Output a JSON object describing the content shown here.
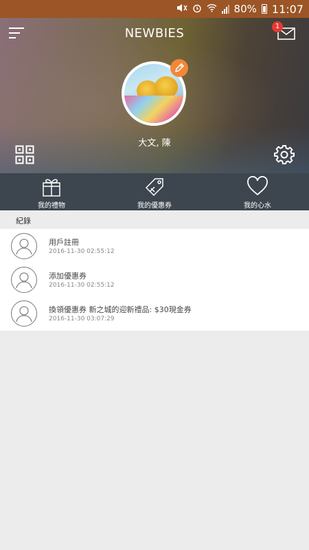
{
  "status_bar": {
    "battery": "80%",
    "time": "11:07",
    "icons": [
      "mute-icon",
      "alarm-icon",
      "wifi-icon",
      "signal-icon",
      "battery-icon"
    ]
  },
  "header": {
    "title": "NEWBIES",
    "mail_badge": "1",
    "user_name": "大文, 陳"
  },
  "tabs": [
    {
      "label": "我的禮物",
      "icon": "gift-icon"
    },
    {
      "label": "我的優惠券",
      "icon": "coupon-icon"
    },
    {
      "label": "我的心水",
      "icon": "heart-icon"
    }
  ],
  "records": {
    "heading": "紀錄",
    "items": [
      {
        "title": "用戶註冊",
        "time": "2016-11-30 02:55:12"
      },
      {
        "title": "添加優惠券",
        "time": "2016-11-30 02:55:12"
      },
      {
        "title": "換領優惠券 新之城的迎新禮品: $30現金券",
        "time": "2016-11-30 03:07:29"
      }
    ]
  },
  "colors": {
    "status_bar": "#9b5526",
    "tab_bar": "#3d464f",
    "edit_badge": "#f0883a",
    "mail_badge": "#e53935"
  }
}
